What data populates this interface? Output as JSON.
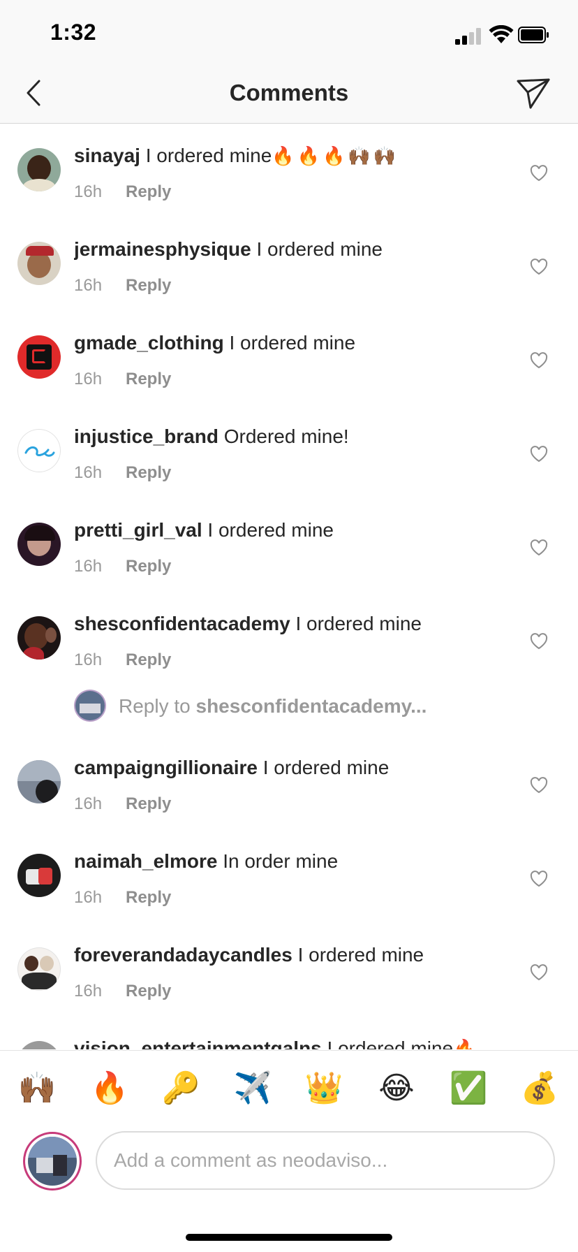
{
  "status_bar": {
    "time": "1:32"
  },
  "header": {
    "title": "Comments"
  },
  "comments": [
    {
      "username": "sinayaj",
      "text": "I ordered mine",
      "emojis": "🔥🔥🔥🙌🏾🙌🏾",
      "time": "16h",
      "reply_label": "Reply"
    },
    {
      "username": "jermainesphysique",
      "text": "I ordered mine",
      "time": "16h",
      "reply_label": "Reply"
    },
    {
      "username": "gmade_clothing",
      "text": "I ordered mine",
      "time": "16h",
      "reply_label": "Reply"
    },
    {
      "username": "injustice_brand",
      "text": "Ordered mine!",
      "time": "16h",
      "reply_label": "Reply"
    },
    {
      "username": "pretti_girl_val",
      "text": "I ordered mine",
      "time": "16h",
      "reply_label": "Reply"
    },
    {
      "username": "shesconfidentacademy",
      "text": "I ordered mine",
      "time": "16h",
      "reply_label": "Reply"
    },
    {
      "username": "campaigngillionaire",
      "text": "I ordered mine",
      "time": "16h",
      "reply_label": "Reply"
    },
    {
      "username": "naimah_elmore",
      "text": "In order mine",
      "time": "16h",
      "reply_label": "Reply"
    },
    {
      "username": "foreverandadaycandles",
      "text": "I ordered mine",
      "time": "16h",
      "reply_label": "Reply"
    },
    {
      "username": "vision_entertainmentgalns",
      "text": "I ordered mine",
      "emojis": "🔥",
      "time": "",
      "reply_label": ""
    }
  ],
  "reply_prompt": {
    "prefix": "Reply to",
    "username": "shesconfidentacademy..."
  },
  "emoji_bar": [
    "🙌🏾",
    "🔥",
    "🔑",
    "✈️",
    "👑",
    "😂",
    "✅",
    "💰"
  ],
  "composer": {
    "placeholder": "Add a comment as neodaviso..."
  },
  "colors": {
    "accent_ring": "#c73b7a",
    "muted_text": "#999999",
    "divider": "#d5d5d5"
  },
  "icons": {
    "back": "chevron-left-icon",
    "share": "paper-plane-icon",
    "like": "heart-outline-icon"
  }
}
